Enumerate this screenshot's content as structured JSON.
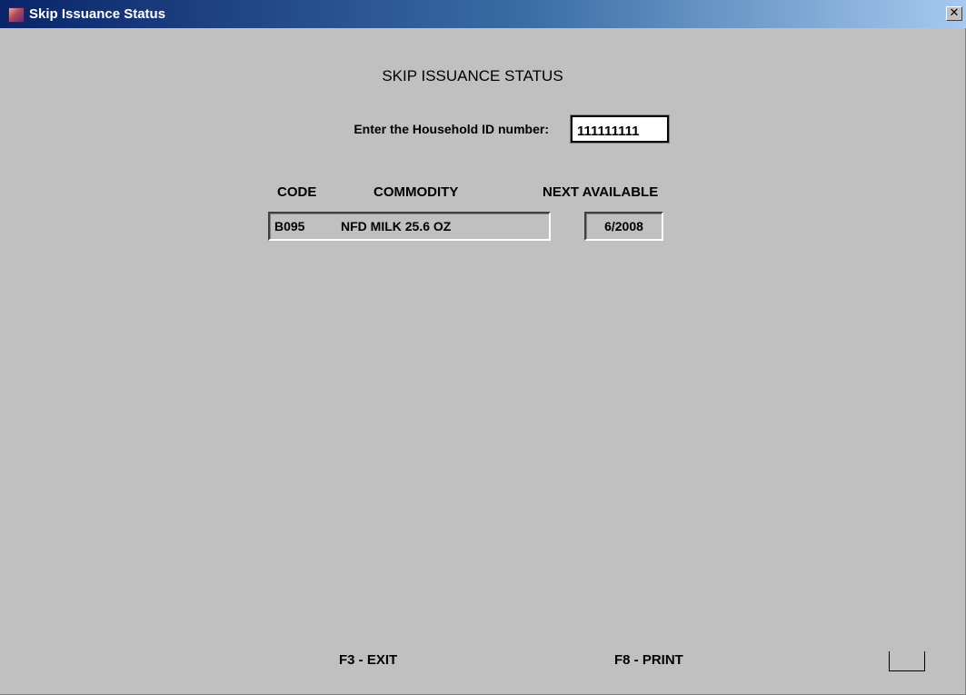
{
  "window": {
    "title": "Skip Issuance Status",
    "close_glyph": "✕",
    "icon": "app-icon"
  },
  "screen": {
    "heading": "SKIP ISSUANCE STATUS",
    "household_label": "Enter the Household ID number:",
    "household_id": "111111111"
  },
  "table": {
    "headers": {
      "code": "CODE",
      "commodity": "COMMODITY",
      "next_available": "NEXT AVAILABLE"
    },
    "rows": [
      {
        "code": "B095",
        "commodity": "NFD MILK 25.6 OZ",
        "next_available": "6/2008"
      }
    ]
  },
  "function_keys": {
    "exit": "F3 - EXIT",
    "print": "F8 - PRINT"
  },
  "colors": {
    "background": "#c0c0c0",
    "titlebar_start": "#0a246a",
    "titlebar_end": "#a6caf0"
  }
}
